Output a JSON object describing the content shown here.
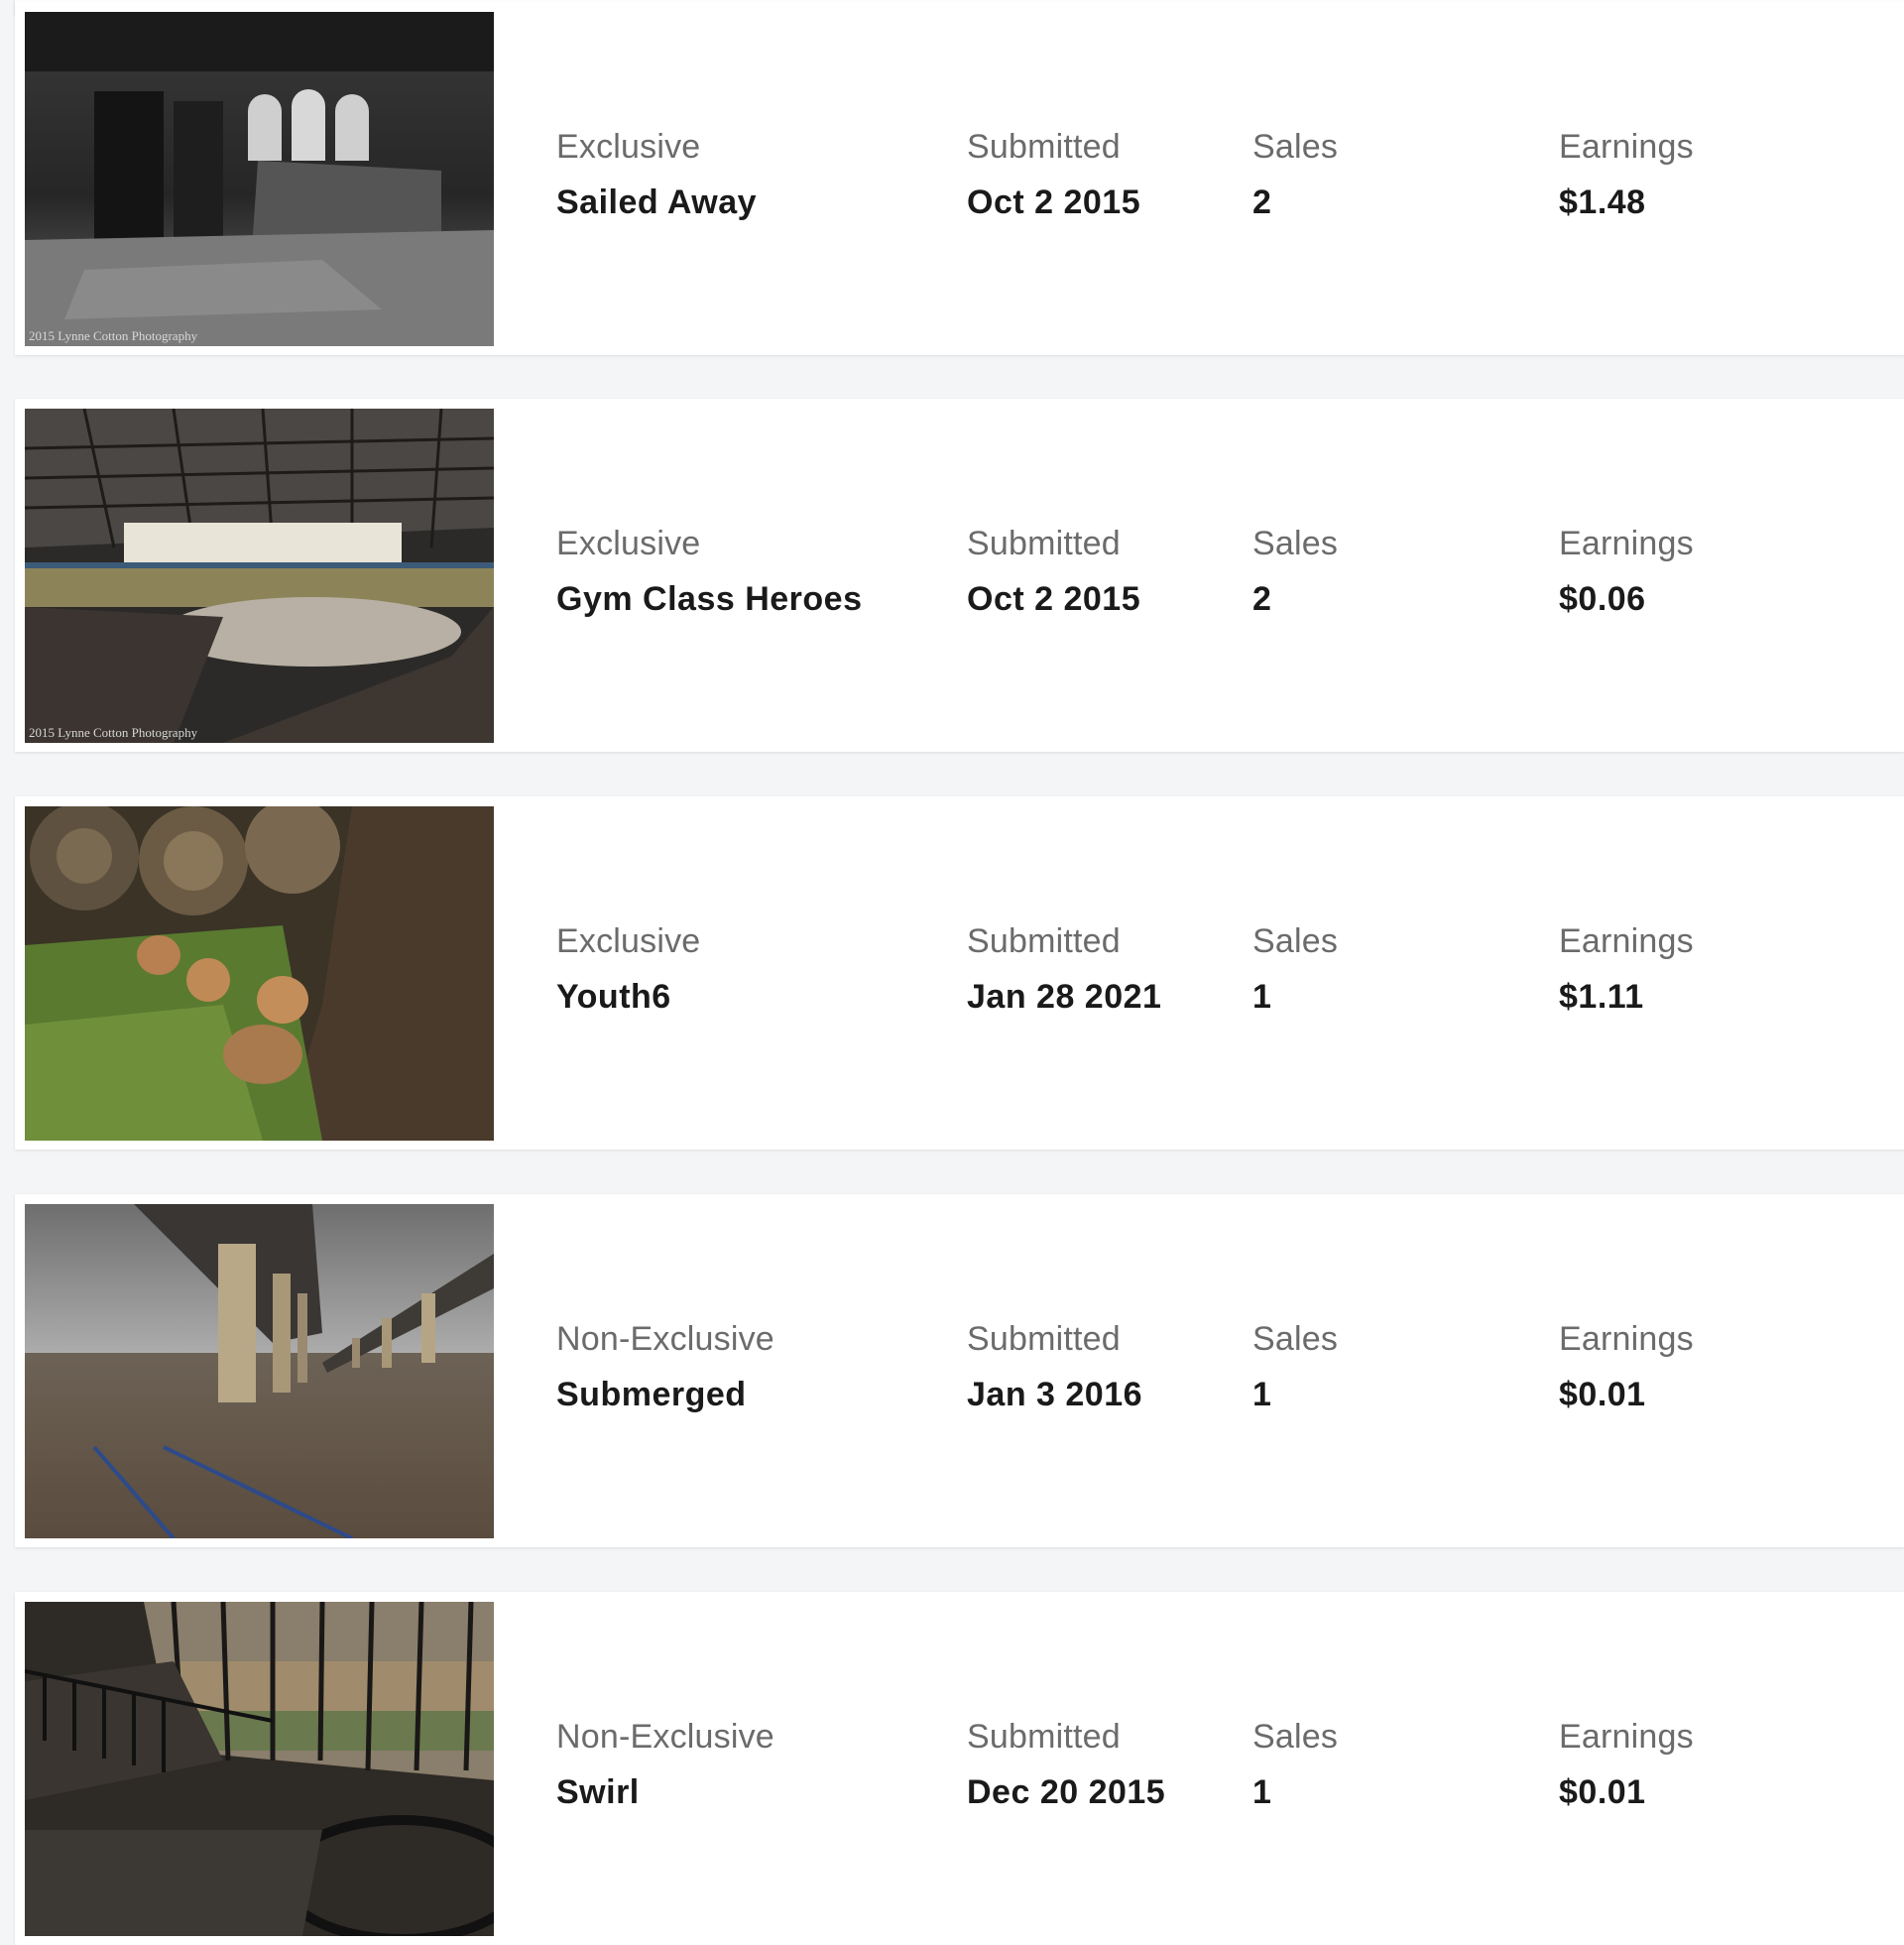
{
  "labels": {
    "submitted": "Submitted",
    "sales": "Sales",
    "earnings": "Earnings"
  },
  "items": [
    {
      "license": "Exclusive",
      "title": "Sailed Away",
      "submitted": "Oct 2 2015",
      "sales": "2",
      "earnings": "$1.48",
      "watermark": "2015 Lynne Cotton Photography",
      "image": "abandoned-room-arched-windows-bw"
    },
    {
      "license": "Exclusive",
      "title": "Gym Class Heroes",
      "submitted": "Oct 2 2015",
      "sales": "2",
      "earnings": "$0.06",
      "watermark": "2015 Lynne Cotton Photography",
      "image": "abandoned-gymnasium"
    },
    {
      "license": "Exclusive",
      "title": "Youth6",
      "submitted": "Jan 28 2021",
      "sales": "1",
      "earnings": "$1.11",
      "image": "fox-kits-by-logs"
    },
    {
      "license": "Non-Exclusive",
      "title": "Submerged",
      "submitted": "Jan 3 2016",
      "sales": "1",
      "earnings": "$0.01",
      "image": "flooded-river-bridges"
    },
    {
      "license": "Non-Exclusive",
      "title": "Swirl",
      "submitted": "Dec 20 2015",
      "sales": "1",
      "earnings": "$0.01",
      "image": "spiral-staircase-windows"
    }
  ]
}
